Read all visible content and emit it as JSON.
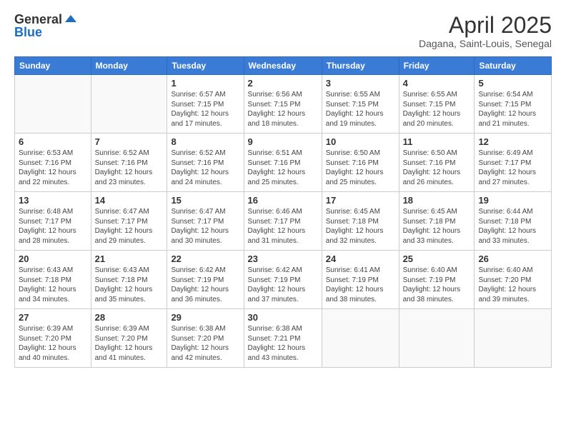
{
  "logo": {
    "general": "General",
    "blue": "Blue"
  },
  "title": {
    "month": "April 2025",
    "location": "Dagana, Saint-Louis, Senegal"
  },
  "weekdays": [
    "Sunday",
    "Monday",
    "Tuesday",
    "Wednesday",
    "Thursday",
    "Friday",
    "Saturday"
  ],
  "weeks": [
    [
      {
        "day": "",
        "info": ""
      },
      {
        "day": "",
        "info": ""
      },
      {
        "day": "1",
        "info": "Sunrise: 6:57 AM\nSunset: 7:15 PM\nDaylight: 12 hours and 17 minutes."
      },
      {
        "day": "2",
        "info": "Sunrise: 6:56 AM\nSunset: 7:15 PM\nDaylight: 12 hours and 18 minutes."
      },
      {
        "day": "3",
        "info": "Sunrise: 6:55 AM\nSunset: 7:15 PM\nDaylight: 12 hours and 19 minutes."
      },
      {
        "day": "4",
        "info": "Sunrise: 6:55 AM\nSunset: 7:15 PM\nDaylight: 12 hours and 20 minutes."
      },
      {
        "day": "5",
        "info": "Sunrise: 6:54 AM\nSunset: 7:15 PM\nDaylight: 12 hours and 21 minutes."
      }
    ],
    [
      {
        "day": "6",
        "info": "Sunrise: 6:53 AM\nSunset: 7:16 PM\nDaylight: 12 hours and 22 minutes."
      },
      {
        "day": "7",
        "info": "Sunrise: 6:52 AM\nSunset: 7:16 PM\nDaylight: 12 hours and 23 minutes."
      },
      {
        "day": "8",
        "info": "Sunrise: 6:52 AM\nSunset: 7:16 PM\nDaylight: 12 hours and 24 minutes."
      },
      {
        "day": "9",
        "info": "Sunrise: 6:51 AM\nSunset: 7:16 PM\nDaylight: 12 hours and 25 minutes."
      },
      {
        "day": "10",
        "info": "Sunrise: 6:50 AM\nSunset: 7:16 PM\nDaylight: 12 hours and 25 minutes."
      },
      {
        "day": "11",
        "info": "Sunrise: 6:50 AM\nSunset: 7:16 PM\nDaylight: 12 hours and 26 minutes."
      },
      {
        "day": "12",
        "info": "Sunrise: 6:49 AM\nSunset: 7:17 PM\nDaylight: 12 hours and 27 minutes."
      }
    ],
    [
      {
        "day": "13",
        "info": "Sunrise: 6:48 AM\nSunset: 7:17 PM\nDaylight: 12 hours and 28 minutes."
      },
      {
        "day": "14",
        "info": "Sunrise: 6:47 AM\nSunset: 7:17 PM\nDaylight: 12 hours and 29 minutes."
      },
      {
        "day": "15",
        "info": "Sunrise: 6:47 AM\nSunset: 7:17 PM\nDaylight: 12 hours and 30 minutes."
      },
      {
        "day": "16",
        "info": "Sunrise: 6:46 AM\nSunset: 7:17 PM\nDaylight: 12 hours and 31 minutes."
      },
      {
        "day": "17",
        "info": "Sunrise: 6:45 AM\nSunset: 7:18 PM\nDaylight: 12 hours and 32 minutes."
      },
      {
        "day": "18",
        "info": "Sunrise: 6:45 AM\nSunset: 7:18 PM\nDaylight: 12 hours and 33 minutes."
      },
      {
        "day": "19",
        "info": "Sunrise: 6:44 AM\nSunset: 7:18 PM\nDaylight: 12 hours and 33 minutes."
      }
    ],
    [
      {
        "day": "20",
        "info": "Sunrise: 6:43 AM\nSunset: 7:18 PM\nDaylight: 12 hours and 34 minutes."
      },
      {
        "day": "21",
        "info": "Sunrise: 6:43 AM\nSunset: 7:18 PM\nDaylight: 12 hours and 35 minutes."
      },
      {
        "day": "22",
        "info": "Sunrise: 6:42 AM\nSunset: 7:19 PM\nDaylight: 12 hours and 36 minutes."
      },
      {
        "day": "23",
        "info": "Sunrise: 6:42 AM\nSunset: 7:19 PM\nDaylight: 12 hours and 37 minutes."
      },
      {
        "day": "24",
        "info": "Sunrise: 6:41 AM\nSunset: 7:19 PM\nDaylight: 12 hours and 38 minutes."
      },
      {
        "day": "25",
        "info": "Sunrise: 6:40 AM\nSunset: 7:19 PM\nDaylight: 12 hours and 38 minutes."
      },
      {
        "day": "26",
        "info": "Sunrise: 6:40 AM\nSunset: 7:20 PM\nDaylight: 12 hours and 39 minutes."
      }
    ],
    [
      {
        "day": "27",
        "info": "Sunrise: 6:39 AM\nSunset: 7:20 PM\nDaylight: 12 hours and 40 minutes."
      },
      {
        "day": "28",
        "info": "Sunrise: 6:39 AM\nSunset: 7:20 PM\nDaylight: 12 hours and 41 minutes."
      },
      {
        "day": "29",
        "info": "Sunrise: 6:38 AM\nSunset: 7:20 PM\nDaylight: 12 hours and 42 minutes."
      },
      {
        "day": "30",
        "info": "Sunrise: 6:38 AM\nSunset: 7:21 PM\nDaylight: 12 hours and 43 minutes."
      },
      {
        "day": "",
        "info": ""
      },
      {
        "day": "",
        "info": ""
      },
      {
        "day": "",
        "info": ""
      }
    ]
  ]
}
